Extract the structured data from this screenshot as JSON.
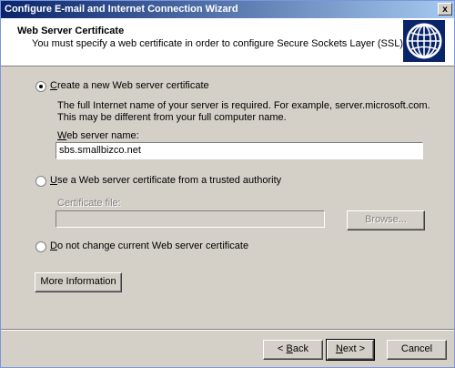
{
  "window": {
    "title": "Configure E-mail and Internet Connection Wizard",
    "close_label": "x"
  },
  "header": {
    "title": "Web Server Certificate",
    "subtitle": "You must specify a web certificate in order to configure Secure Sockets Layer (SSL)."
  },
  "options": {
    "create": {
      "label_accel": "C",
      "label_rest": "reate a new Web server certificate",
      "checked": true,
      "description": "The full Internet name of your server is required. For example, server.microsoft.com. This may be different from your full computer name.",
      "field_label_accel": "W",
      "field_label_rest": "eb server name:",
      "field_value": "sbs.smallbizco.net"
    },
    "trusted": {
      "label_accel": "U",
      "label_rest": "se a Web server certificate from a trusted authority",
      "checked": false,
      "field_label": "Certificate file:",
      "field_value": "",
      "browse_label": "Browse..."
    },
    "nochange": {
      "label_accel": "D",
      "label_rest": "o not change current Web server certificate",
      "checked": false
    }
  },
  "more_info": {
    "label": "More Information"
  },
  "footer": {
    "back_accel": "B",
    "back_prefix": "< ",
    "back_rest": "ack",
    "next_accel": "N",
    "next_rest": "ext >",
    "cancel_label": "Cancel"
  },
  "colors": {
    "titlebar_start": "#0a246a",
    "titlebar_end": "#a6caf0",
    "dialog_bg": "#d4d0c8"
  },
  "icons": {
    "header": "globe-icon"
  }
}
